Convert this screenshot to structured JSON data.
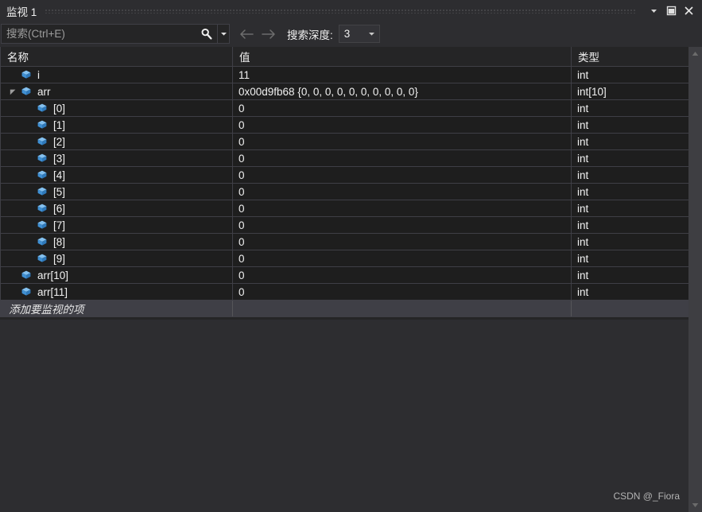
{
  "window": {
    "title": "监视 1",
    "buttons": [
      {
        "name": "window-dropdown-button",
        "icon": "chevron-down-icon",
        "label": "▼"
      },
      {
        "name": "window-maximize-button",
        "icon": "maximize-icon",
        "label": "□"
      },
      {
        "name": "window-close-button",
        "icon": "close-icon",
        "label": "✕"
      }
    ]
  },
  "toolbar": {
    "search_placeholder": "搜索(Ctrl+E)",
    "search_value": "",
    "search_icon": "search-icon",
    "search_dropdown_icon": "chevron-down-icon",
    "back_icon": "arrow-left-icon",
    "forward_icon": "arrow-right-icon",
    "depth_label": "搜索深度:",
    "depth_value": "3",
    "depth_caret_icon": "chevron-down-icon"
  },
  "grid": {
    "columns": [
      {
        "key": "name",
        "label": "名称"
      },
      {
        "key": "value",
        "label": "值"
      },
      {
        "key": "type",
        "label": "类型"
      }
    ],
    "rows": [
      {
        "indent": 1,
        "expander": "none",
        "icon": "variable-cube-icon",
        "name": "i",
        "value": "11",
        "type": "int"
      },
      {
        "indent": 1,
        "expander": "expanded",
        "icon": "variable-cube-icon",
        "name": "arr",
        "value": "0x00d9fb68 {0, 0, 0, 0, 0, 0, 0, 0, 0, 0}",
        "type": "int[10]"
      },
      {
        "indent": 2,
        "expander": "none",
        "icon": "variable-cube-icon",
        "name": "[0]",
        "value": "0",
        "type": "int"
      },
      {
        "indent": 2,
        "expander": "none",
        "icon": "variable-cube-icon",
        "name": "[1]",
        "value": "0",
        "type": "int"
      },
      {
        "indent": 2,
        "expander": "none",
        "icon": "variable-cube-icon",
        "name": "[2]",
        "value": "0",
        "type": "int"
      },
      {
        "indent": 2,
        "expander": "none",
        "icon": "variable-cube-icon",
        "name": "[3]",
        "value": "0",
        "type": "int"
      },
      {
        "indent": 2,
        "expander": "none",
        "icon": "variable-cube-icon",
        "name": "[4]",
        "value": "0",
        "type": "int"
      },
      {
        "indent": 2,
        "expander": "none",
        "icon": "variable-cube-icon",
        "name": "[5]",
        "value": "0",
        "type": "int"
      },
      {
        "indent": 2,
        "expander": "none",
        "icon": "variable-cube-icon",
        "name": "[6]",
        "value": "0",
        "type": "int"
      },
      {
        "indent": 2,
        "expander": "none",
        "icon": "variable-cube-icon",
        "name": "[7]",
        "value": "0",
        "type": "int"
      },
      {
        "indent": 2,
        "expander": "none",
        "icon": "variable-cube-icon",
        "name": "[8]",
        "value": "0",
        "type": "int"
      },
      {
        "indent": 2,
        "expander": "none",
        "icon": "variable-cube-icon",
        "name": "[9]",
        "value": "0",
        "type": "int"
      },
      {
        "indent": 1,
        "expander": "none",
        "icon": "variable-cube-icon",
        "name": "arr[10]",
        "value": "0",
        "type": "int"
      },
      {
        "indent": 1,
        "expander": "none",
        "icon": "variable-cube-icon",
        "name": "arr[11]",
        "value": "0",
        "type": "int"
      }
    ],
    "add_row": {
      "name": "添加要监视的项",
      "value": "",
      "type": ""
    }
  },
  "scrollbar": {
    "up_icon": "triangle-up-icon",
    "down_icon": "triangle-down-icon"
  },
  "watermark": "CSDN @_Fiora",
  "colors": {
    "window_bg": "#2d2d30",
    "grid_bg": "#1e1e1e",
    "header_bg": "#252526",
    "gridline": "#3f3f46",
    "text": "#f1f1f1",
    "placeholder": "#9d9d9d",
    "add_row_bg": "#3f3f46",
    "icon_blue": "#5ba7e8",
    "scroll_bg": "#3e3e42"
  }
}
